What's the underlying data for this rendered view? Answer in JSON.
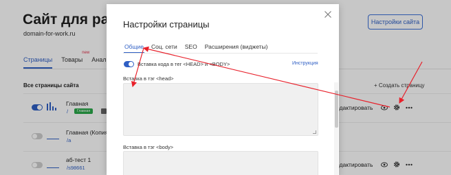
{
  "site": {
    "title": "Сайт для работ",
    "domain": "domain-for-work.ru",
    "settings_button": "Настройки сайта",
    "tabs": [
      {
        "label": "Страницы",
        "active": true
      },
      {
        "label": "Товары",
        "badge": "new"
      },
      {
        "label": "Аналит"
      }
    ],
    "all_pages_label": "Все страницы сайта",
    "create_page_label": "+ Создать страницу"
  },
  "pages": [
    {
      "name": "Главная",
      "path": "/",
      "badge": "Главная",
      "edit_label": "едактировать",
      "enabled": true
    },
    {
      "name": "Главная (Копия",
      "path": "/a",
      "edit_label": "",
      "enabled": false
    },
    {
      "name": "аб-тест 1",
      "path": "/s98661",
      "edit_label": "едактировать",
      "enabled": false
    }
  ],
  "modal": {
    "title": "Настройки страницы",
    "tabs": [
      {
        "label": "Общие",
        "active": true
      },
      {
        "label": "Соц. сети"
      },
      {
        "label": "SEO"
      },
      {
        "label": "Расширения (виджеты)"
      }
    ],
    "toggle_label": "Вставка кода в тег <HEAD> и <BODY>",
    "toggle_on": true,
    "instruction_link": "Инструкция",
    "head_label": "Вставка в тэг <head>",
    "head_value": "",
    "body_label": "Вставка в тэг <body>",
    "body_value": ""
  },
  "colors": {
    "accent": "#2f5fc4",
    "annotation_arrow": "#e8202a",
    "main_badge": "#2aa84a"
  }
}
